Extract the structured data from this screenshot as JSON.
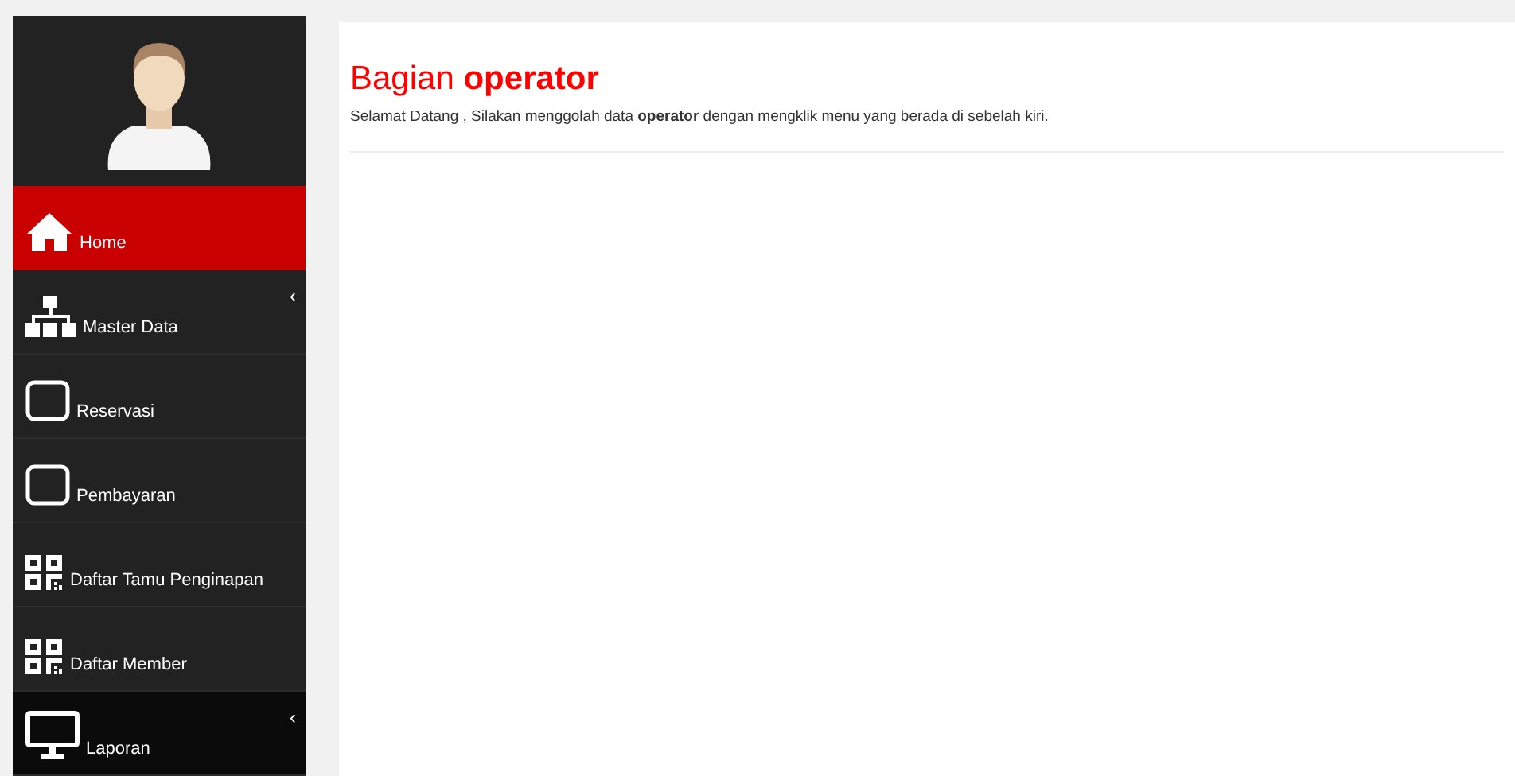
{
  "sidebar": {
    "items": [
      {
        "kind": "home",
        "label": "Home",
        "selected": true,
        "highlighted": false
      },
      {
        "kind": "sitemap",
        "label": "Master Data",
        "caret": "‹",
        "selected": false,
        "highlighted": false
      },
      {
        "kind": "square",
        "label": "Reservasi",
        "selected": false,
        "highlighted": false
      },
      {
        "kind": "square",
        "label": "Pembayaran",
        "selected": false,
        "highlighted": false
      },
      {
        "kind": "qrcode",
        "label": "Daftar Tamu Penginapan",
        "selected": false,
        "highlighted": false
      },
      {
        "kind": "qrcode",
        "label": "Daftar Member",
        "selected": false,
        "highlighted": false
      },
      {
        "kind": "monitor",
        "label": "Laporan",
        "caret": "‹",
        "selected": false,
        "highlighted": true
      }
    ]
  },
  "content": {
    "title": "Bagian **operator**",
    "subtitle": "Selamat Datang , Silakan menggolah data **operator** dengan mengklik menu yang berada di sebelah kiri."
  }
}
